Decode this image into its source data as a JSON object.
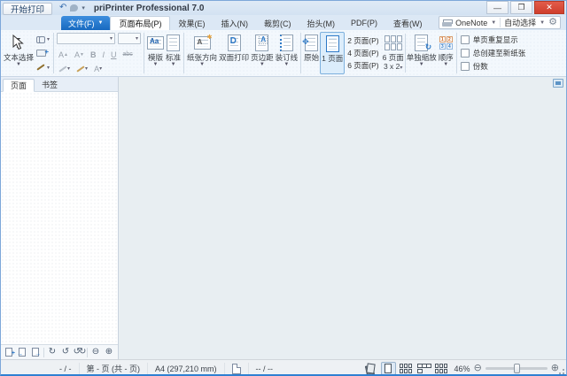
{
  "titlebar": {
    "start_print": "开始打印",
    "title": "priPrinter Professional 7.0"
  },
  "window_controls": {
    "minimize": "—",
    "restore": "❐",
    "close": "✕"
  },
  "tabs": {
    "file": "文件(F)",
    "page_layout": "页面布局(P)",
    "effects": "效果(E)",
    "insert": "插入(N)",
    "crop": "裁剪(C)",
    "letterhead": "抬头(M)",
    "pdf": "PDF(P)",
    "view": "查看(W)"
  },
  "printer_selector": {
    "printer": "OneNote",
    "mode": "自动选择"
  },
  "ribbon": {
    "text_selection": "文本选择",
    "font": {
      "grow": "A",
      "shrink": "A",
      "bold": "B",
      "italic": "I",
      "underline": "U",
      "strike": "abc",
      "color": "A"
    },
    "templates": "模版",
    "normal": "标准",
    "orientation": "纸张方向",
    "duplex": "双面打印",
    "margins": "页边距",
    "gutter": "装订线",
    "original": "原始",
    "one_page": "1 页面",
    "two_pages": "2 页面(P)",
    "four_pages": "4 页面(P)",
    "six_pages_item": "6 页面(P)",
    "six_pages": "6 页面",
    "six_pages_grid": "3 x 2",
    "independent_zoom": "单独缩放",
    "order": "顺序",
    "cb_repeat": "单页重复显示",
    "cb_new_paper": "总创建至新纸张",
    "cb_copies": "份数",
    "icon_letters": {
      "template": "Aa",
      "duplex": "D",
      "margins": "A",
      "orientation": "A",
      "order": [
        "1",
        "2",
        "3",
        "4"
      ]
    }
  },
  "sidebar": {
    "tab_pages": "页面",
    "tab_bookmarks": "书签"
  },
  "statusbar": {
    "selection": "- / -",
    "page_info": "第 - 页 (共 - 页)",
    "paper": "A4 (297,210 mm)",
    "coords": "-- / --",
    "zoom": "46%"
  }
}
